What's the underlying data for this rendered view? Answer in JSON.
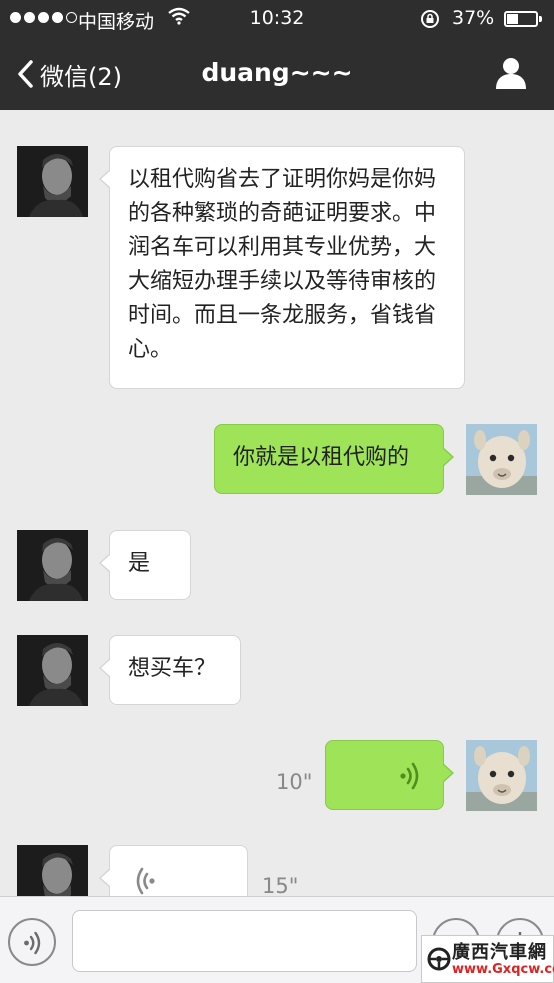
{
  "status_bar": {
    "carrier": "中国移动",
    "time": "10:32",
    "battery_percent": "37%",
    "battery_level": 0.37,
    "signal_bars": 4,
    "signal_max": 5
  },
  "nav": {
    "back_label": "微信(2)",
    "title": "duang~~~"
  },
  "messages": [
    {
      "from": "contact",
      "type": "text",
      "text": "以租代购省去了证明你妈是你妈的各种繁琐的奇葩证明要求。中润名车可以利用其专业优势，大大缩短办理手续以及等待审核的时间。而且一条龙服务，省钱省心。"
    },
    {
      "from": "me",
      "type": "text",
      "text": "你就是以租代购的"
    },
    {
      "from": "contact",
      "type": "text",
      "text": "是"
    },
    {
      "from": "contact",
      "type": "text",
      "text": "想买车？"
    },
    {
      "from": "me",
      "type": "voice",
      "duration": "10\""
    },
    {
      "from": "contact",
      "type": "voice",
      "duration": "15\""
    }
  ],
  "watermark": {
    "name": "廣西汽車網",
    "url": "www.Gxqcw.com"
  },
  "colors": {
    "bar": "#2e2e2f",
    "chat_bg": "#ebebeb",
    "outgoing_bubble": "#9fe358",
    "incoming_bubble": "#ffffff",
    "voice_wave_out": "#4f8e1f"
  },
  "icons": {
    "back": "chevron-left-icon",
    "profile": "person-icon",
    "voice": "voice-wave-icon",
    "emoji": "smiley-icon",
    "more": "plus-icon"
  }
}
